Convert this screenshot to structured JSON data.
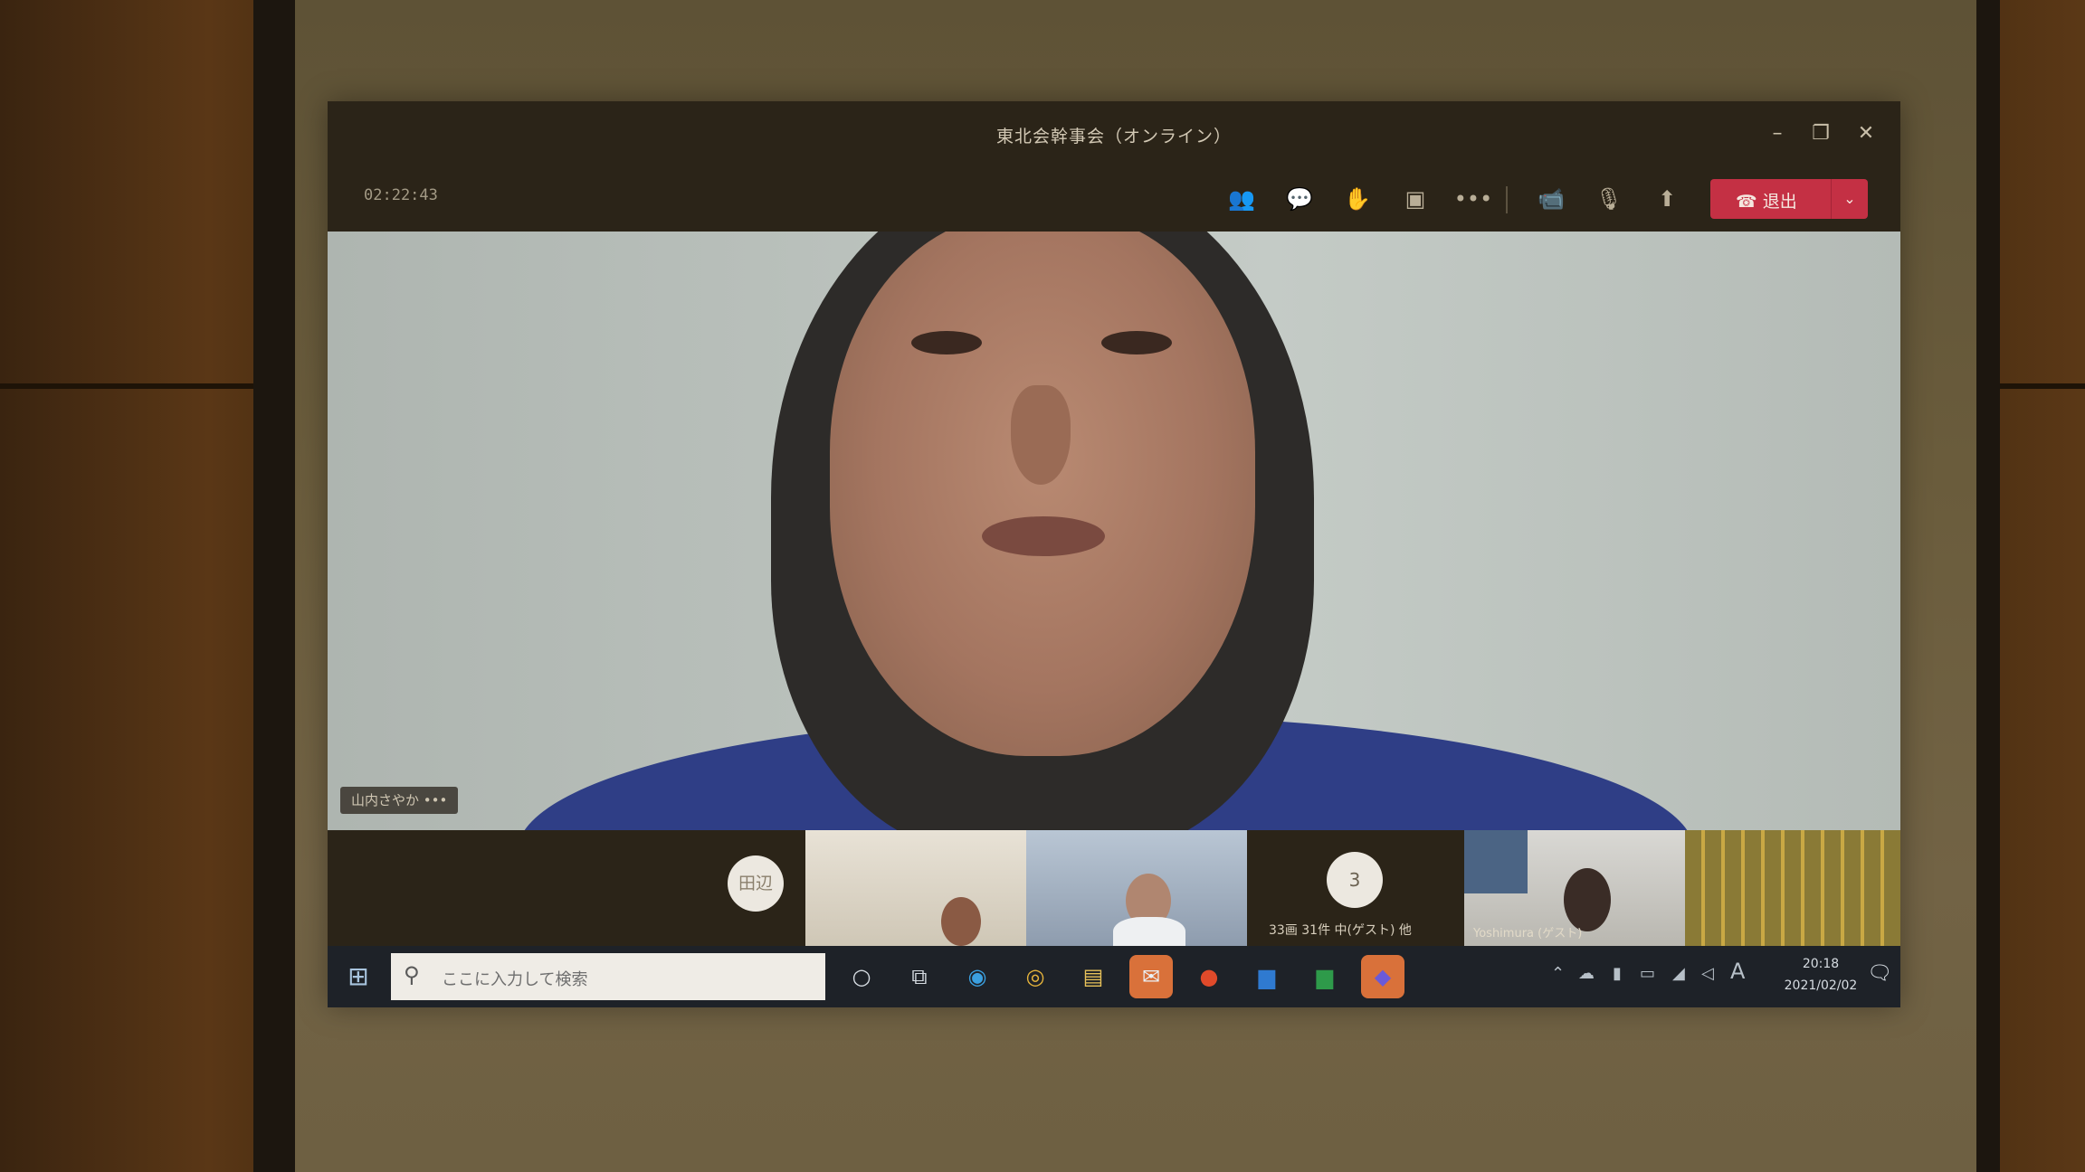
{
  "window": {
    "title": "東北会幹事会（オンライン）",
    "minimize": "–",
    "maximize": "❐",
    "close": "✕"
  },
  "toolbar": {
    "elapsed": "02:22:43",
    "participants_icon": "participants-icon",
    "chat_icon": "chat-icon",
    "raise_hand_icon": "raise-hand-icon",
    "rooms_icon": "breakout-rooms-icon",
    "more_label": "•••",
    "camera_icon": "camera-icon",
    "mic_icon": "microphone-icon",
    "share_icon": "share-screen-icon",
    "leave_label": "退出",
    "leave_chevron": "⌄"
  },
  "main_video": {
    "speaker_name": "山内さやか",
    "speaker_extra": "•••"
  },
  "participants": {
    "avatar_initials": "田辺",
    "overflow_count": "3",
    "overflow_label": "33画 31件 中(ゲスト) 他",
    "guest_label": "Yoshimura (ゲスト)"
  },
  "taskbar": {
    "start_icon": "windows-start-icon",
    "search_placeholder": "ここに入力して検索",
    "ime_indicator": "A",
    "time": "20:18",
    "date": "2021/02/02"
  },
  "colors": {
    "leave_red": "#c43044",
    "taskbar_bg": "#1e2228",
    "sweater_blue": "#2f3e86"
  }
}
